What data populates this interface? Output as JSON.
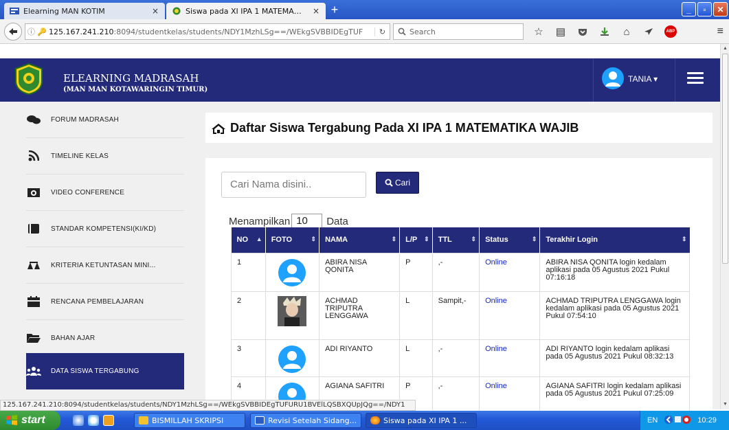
{
  "browser": {
    "tabs": [
      {
        "label": "Elearning MAN KOTIM",
        "close": "×"
      },
      {
        "label": "Siswa pada XI IPA 1 MATEMA…",
        "close": "×"
      }
    ],
    "newtab": "+",
    "url_host": "125.167.241.210",
    "url_rest": ":8094/studentkelas/students/NDY1MzhLSg==/WEkgSVBBIDEgTUF",
    "search_placeholder": "Search",
    "status_url": "125.167.241.210:8094/studentkelas/students/NDY1MzhLSg==/WEkgSVBBIDEgTUFURU1BVElLQSBXQUpJQg==/NDY1"
  },
  "header": {
    "brand_title": "ELEARNING MADRASAH",
    "brand_subtitle": "(MAN MAN KOTAWARINGIN TIMUR)",
    "user_name": "TANIA"
  },
  "sidebar": {
    "items": [
      {
        "label": "FORUM MADRASAH",
        "icon": "comments-icon"
      },
      {
        "label": "TIMELINE KELAS",
        "icon": "rss-icon"
      },
      {
        "label": "VIDEO CONFERENCE",
        "icon": "camera-icon"
      },
      {
        "label": "STANDAR KOMPETENSI(KI/KD)",
        "icon": "book-icon"
      },
      {
        "label": "KRITERIA KETUNTASAN MINI...",
        "icon": "balance-scale-icon"
      },
      {
        "label": "RENCANA PEMBELAJARAN",
        "icon": "calendar-icon"
      },
      {
        "label": "BAHAN AJAR",
        "icon": "folder-open-icon"
      },
      {
        "label": "DATA SISWA TERGABUNG",
        "icon": "users-icon",
        "active": true
      }
    ]
  },
  "main": {
    "title": "Daftar Siswa Tergabung Pada XI IPA 1 MATEMATIKA WAJIB",
    "search_placeholder": "Cari Nama disini..",
    "search_button": "Cari",
    "length_prefix": "Menampilkan",
    "length_value": "10",
    "length_suffix": "Data",
    "table": {
      "columns": [
        "NO",
        "FOTO",
        "NAMA",
        "L/P",
        "TTL",
        "Status",
        "Terakhir Login"
      ],
      "rows": [
        {
          "no": "1",
          "photo": "avatar",
          "nama": "ABIRA NISA QONITA",
          "lp": "P",
          "ttl": ",-",
          "status": "Online",
          "login": "ABIRA NISA QONITA login kedalam aplikasi pada 05 Agustus 2021 Pukul 07:16:18"
        },
        {
          "no": "2",
          "photo": "picture",
          "nama": "ACHMAD TRIPUTRA LENGGAWA",
          "lp": "L",
          "ttl": "Sampit,-",
          "status": "Online",
          "login": "ACHMAD TRIPUTRA LENGGAWA login kedalam aplikasi pada 05 Agustus 2021 Pukul 07:54:10"
        },
        {
          "no": "3",
          "photo": "avatar",
          "nama": "ADI RIYANTO",
          "lp": "L",
          "ttl": ",-",
          "status": "Online",
          "login": "ADI RIYANTO login kedalam aplikasi pada 05 Agustus 2021 Pukul 08:32:13"
        },
        {
          "no": "4",
          "photo": "avatar",
          "nama": "AGIANA SAFITRI",
          "lp": "P",
          "ttl": ",-",
          "status": "Online",
          "login": "AGIANA SAFITRI login kedalam aplikasi pada 05 Agustus 2021 Pukul 07:25:09"
        }
      ]
    }
  },
  "taskbar": {
    "start": "start",
    "items": [
      {
        "label": "BISMILLAH SKRIPSI"
      },
      {
        "label": "Revisi Setelah Sidang..."
      },
      {
        "label": "Siswa pada XI IPA 1 ..."
      }
    ],
    "lang": "EN",
    "time": "10:29"
  },
  "colors": {
    "brand": "#242a7a",
    "accent_avatar": "#1ea1ff",
    "status_online": "#1226c8"
  }
}
